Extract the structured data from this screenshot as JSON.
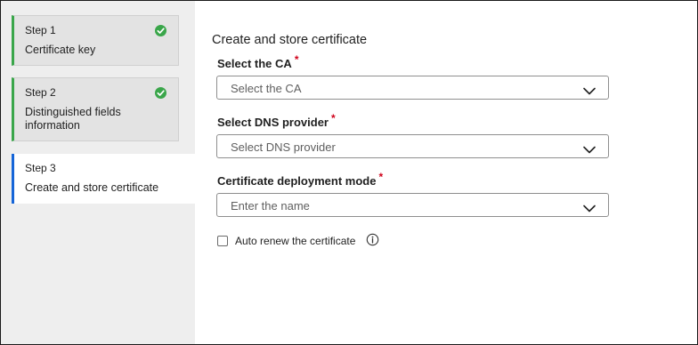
{
  "sidebar": {
    "steps": [
      {
        "number": "Step 1",
        "title": "Certificate key",
        "status": "complete"
      },
      {
        "number": "Step 2",
        "title": "Distinguished fields information",
        "status": "complete"
      },
      {
        "number": "Step 3",
        "title": "Create and store certificate",
        "status": "active"
      }
    ]
  },
  "main": {
    "title": "Create and store certificate",
    "fields": {
      "ca": {
        "label": "Select the CA",
        "required_mark": "*",
        "placeholder": "Select the CA"
      },
      "dns": {
        "label": "Select DNS provider",
        "required_mark": "*",
        "placeholder": "Select DNS provider"
      },
      "mode": {
        "label": "Certificate deployment mode",
        "required_mark": "*",
        "placeholder": "Enter the name"
      }
    },
    "auto_renew": {
      "label": "Auto renew the certificate",
      "checked": false
    }
  },
  "icons": {
    "complete": "check-circle-icon",
    "dropdown": "chevron-down-icon",
    "info": "info-icon"
  },
  "colors": {
    "complete": "#3aa64a",
    "active": "#1565d8",
    "required": "#d0021b",
    "sidebar_bg": "#eeeeee"
  }
}
